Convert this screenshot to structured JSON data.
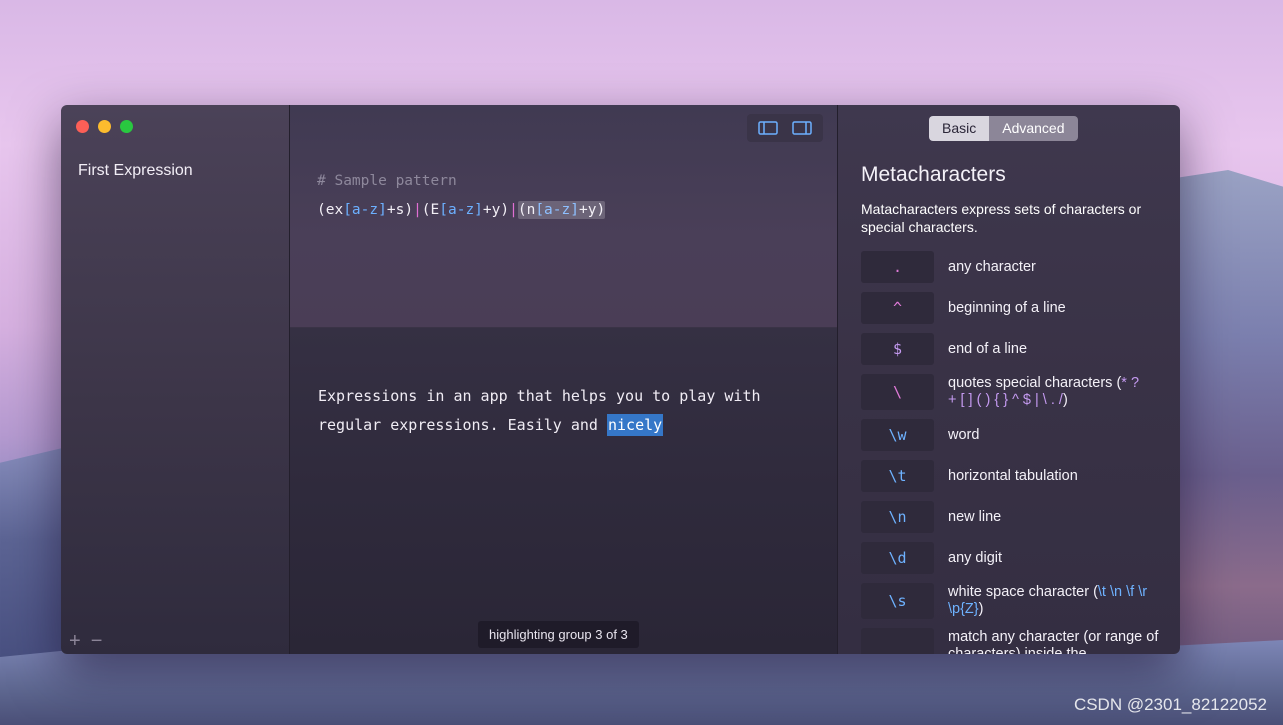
{
  "window": {
    "sidebar": {
      "items": [
        {
          "label": "First Expression"
        }
      ],
      "add_label": "+",
      "remove_label": "−"
    },
    "editor": {
      "comment": "# Sample pattern",
      "pattern": {
        "t1": "(ex",
        "t2": "[a-z]",
        "t3": "+s)",
        "t4": "|",
        "t5": "(E",
        "t6": "[a-z]",
        "t7": "+y)",
        "t8": "|",
        "g1": "(n",
        "g2": "[a-z]",
        "g3": "+y)"
      },
      "toggles": [
        "sidebar-left-toggle",
        "sidebar-right-toggle"
      ]
    },
    "sample": {
      "text_before": "Expressions in an app that helps you to play with regular expressions. Easily and ",
      "highlight": "nicely"
    },
    "status": "highlighting group 3 of 3",
    "reference": {
      "tabs": [
        {
          "label": "Basic",
          "active": true
        },
        {
          "label": "Advanced",
          "active": false
        }
      ],
      "title": "Metacharacters",
      "description": "Matacharacters express sets of characters or special characters.",
      "items": [
        {
          "key": ".",
          "desc": "any character",
          "color": "#e07ad8"
        },
        {
          "key": "^",
          "desc": "beginning of a line",
          "color": "#e07ad8"
        },
        {
          "key": "$",
          "desc": "end of a line",
          "color": "#c49af0"
        },
        {
          "key": "\\",
          "desc": "quotes special characters (",
          "desc_chars_1": "* ?",
          "desc_chars_2": "+ [ ] ( ) { } ^ $ | \\ . /",
          "desc_end": ")",
          "color": "#e07ad8"
        },
        {
          "key": "\\w",
          "desc": "word",
          "color": "#6eb2ff"
        },
        {
          "key": "\\t",
          "desc": "horizontal tabulation",
          "color": "#6eb2ff"
        },
        {
          "key": "\\n",
          "desc": "new line",
          "color": "#6eb2ff"
        },
        {
          "key": "\\d",
          "desc": "any digit",
          "color": "#6eb2ff"
        },
        {
          "key": "\\s",
          "desc": "white space character (",
          "desc_chars_1": "\\t \\n \\f \\r",
          "desc_chars_2": "\\p{Z}",
          "desc_end": ")",
          "color": "#6eb2ff"
        },
        {
          "key": "",
          "desc": "match any character (or range of characters) inside the",
          "color": "#6eb2ff"
        }
      ]
    }
  },
  "watermark": "CSDN @2301_82122052"
}
